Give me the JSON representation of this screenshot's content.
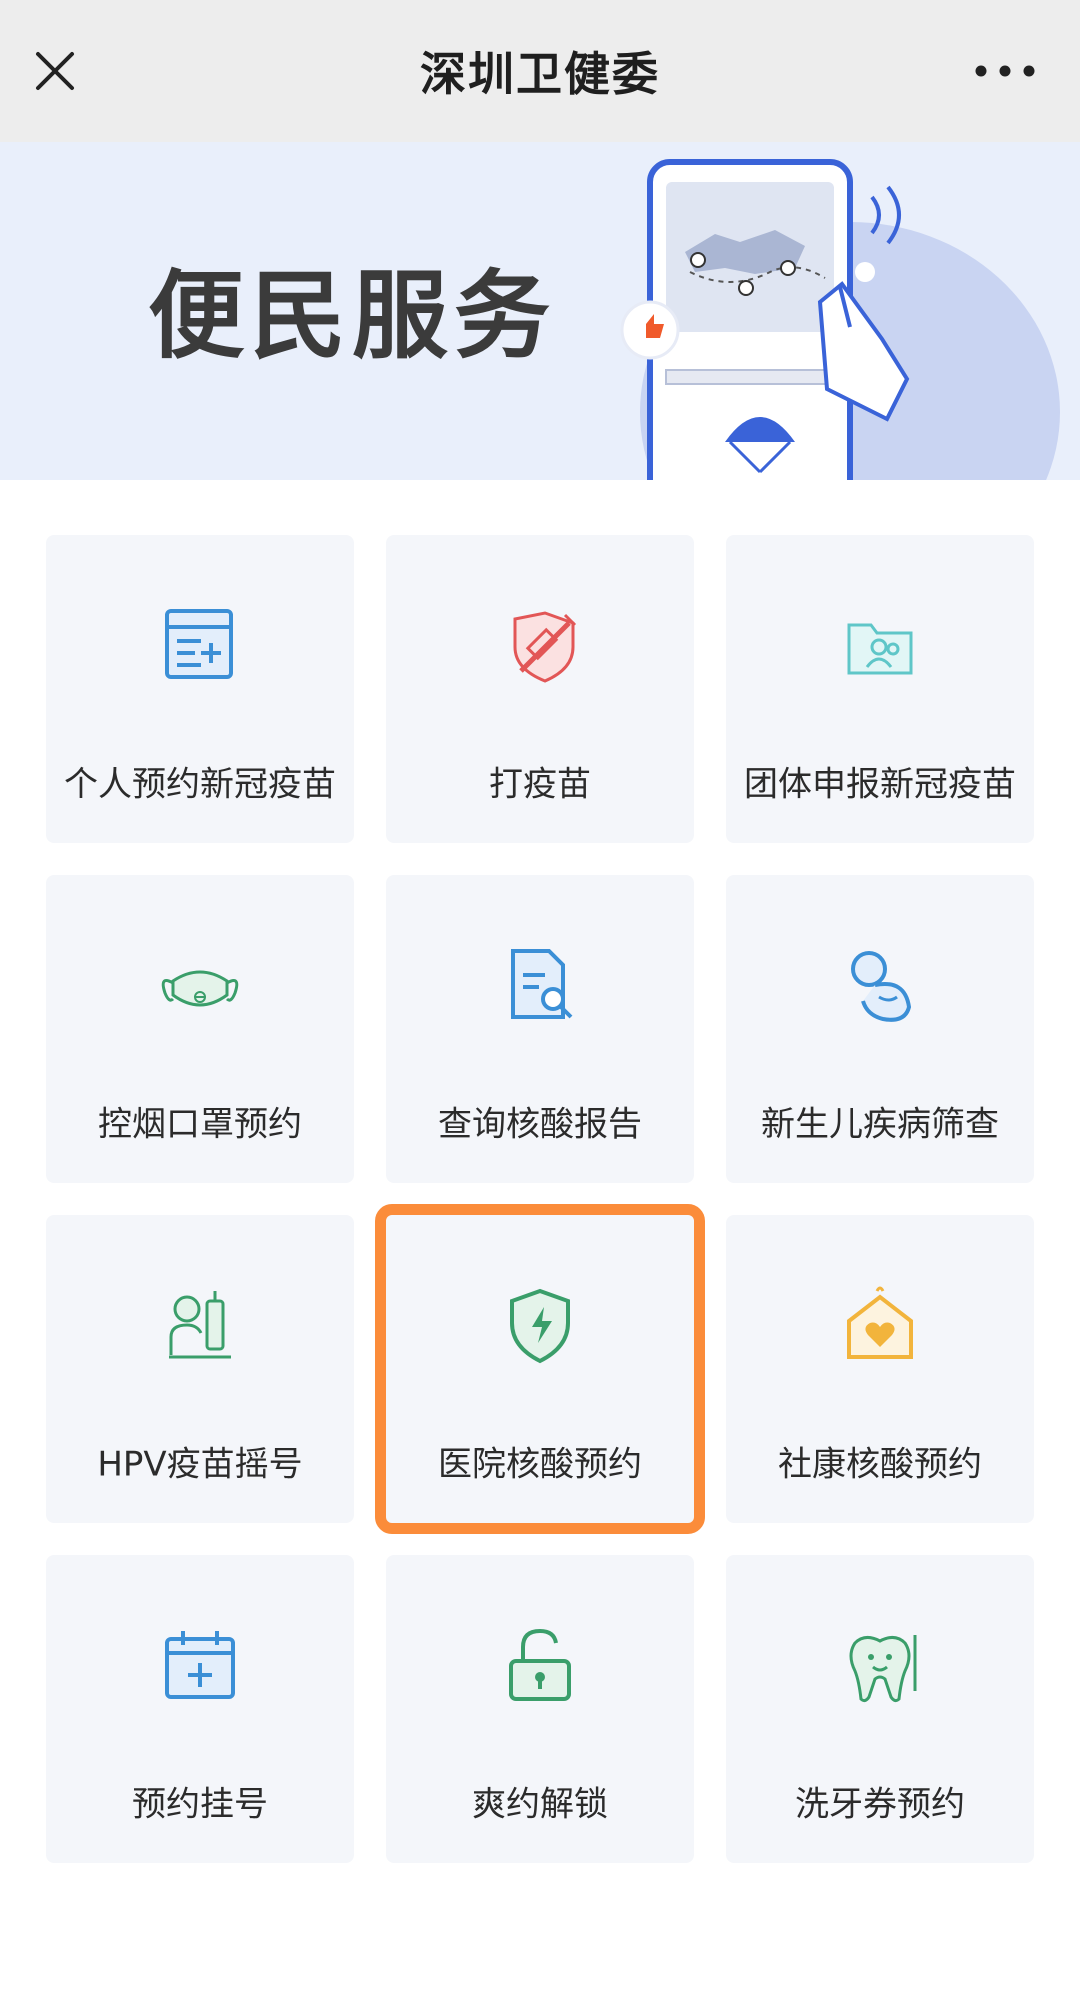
{
  "header": {
    "title": "深圳卫健委",
    "close_icon": "close-icon",
    "more_icon": "more-icon"
  },
  "banner": {
    "title": "便民服务"
  },
  "services": [
    {
      "label": "个人预约新冠疫苗",
      "icon": "calendar-add-icon",
      "color": "#3b8fd6"
    },
    {
      "label": "打疫苗",
      "icon": "vaccine-shield-icon",
      "color": "#e25656"
    },
    {
      "label": "团体申报新冠疫苗",
      "icon": "group-folder-icon",
      "color": "#5fc6c8"
    },
    {
      "label": "控烟口罩预约",
      "icon": "mask-icon",
      "color": "#3a9e6a"
    },
    {
      "label": "查询核酸报告",
      "icon": "report-search-icon",
      "color": "#3b8fd6"
    },
    {
      "label": "新生儿疾病筛查",
      "icon": "baby-icon",
      "color": "#3b8fd6"
    },
    {
      "label": "HPV疫苗摇号",
      "icon": "hpv-vaccine-icon",
      "color": "#3a9e6a"
    },
    {
      "label": "医院核酸预约",
      "icon": "shield-bolt-icon",
      "color": "#3a9e6a"
    },
    {
      "label": "社康核酸预约",
      "icon": "house-heart-icon",
      "color": "#f2b43c"
    },
    {
      "label": "预约挂号",
      "icon": "calendar-plus-icon",
      "color": "#3b8fd6"
    },
    {
      "label": "爽约解锁",
      "icon": "unlock-icon",
      "color": "#3a9e6a"
    },
    {
      "label": "洗牙券预约",
      "icon": "tooth-icon",
      "color": "#3a9e6a"
    }
  ],
  "highlight": {
    "label": "医院核酸预约",
    "color": "#fb8c3a"
  }
}
